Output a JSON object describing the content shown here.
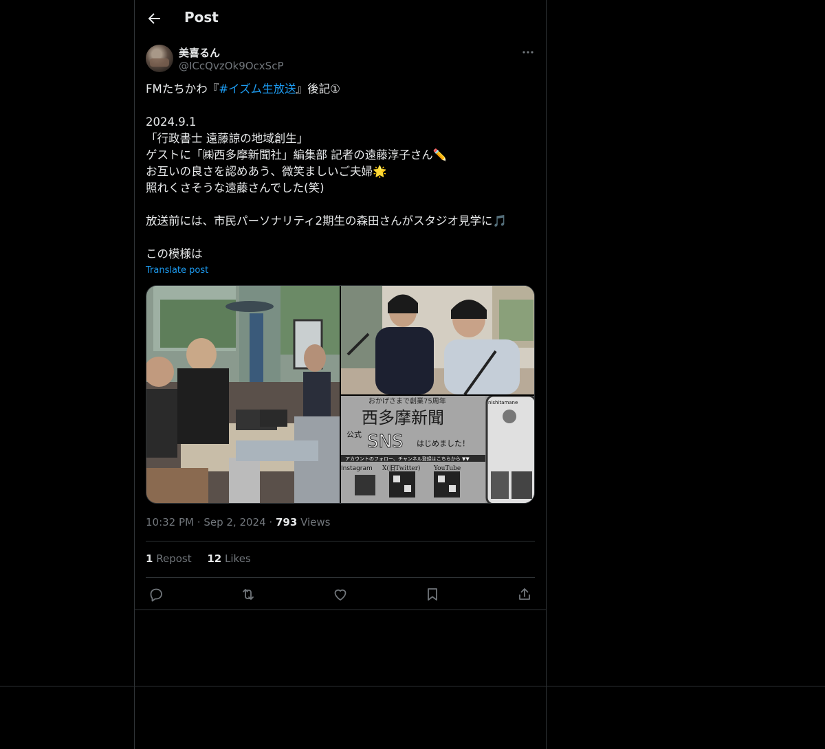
{
  "header": {
    "title": "Post"
  },
  "author": {
    "display_name": "美喜るん",
    "handle": "@ICcQvzOk9OcxScP"
  },
  "post": {
    "line1_prefix": "FMたちかわ『",
    "line1_hashtag": "#イズム生放送",
    "line1_suffix": "』後記①",
    "body": "2024.9.1\n「行政書士 遠藤諒の地域創生」\nゲストに「㈱西多摩新聞社」編集部 記者の遠藤淳子さん✏️\nお互いの良さを認めあう、微笑ましいご夫婦🌟\n照れくさそうな遠藤さんでした(笑)\n\n放送前には、市民パーソナリティ2期生の森田さんがスタジオ見学に🎵\n\nこの模様は",
    "translate_label": "Translate post"
  },
  "media": {
    "sign": {
      "banner_top": "おかげさまで創業75周年",
      "title": "西多摩新聞",
      "badge": "公式",
      "sns": "SNS",
      "sns_suffix": "はじめました！",
      "follow": "アカウントのフォロー、チャンネル登録はこちらから ▼▼",
      "col1": "Instagram",
      "col2": "X(旧Twitter)",
      "col3": "YouTube",
      "profile": "nishitamane"
    }
  },
  "meta": {
    "time": "10:32 PM",
    "date": "Sep 2, 2024",
    "views_count": "793",
    "views_label": "Views",
    "sep": "·"
  },
  "stats": {
    "reposts_count": "1",
    "reposts_label": "Repost",
    "likes_count": "12",
    "likes_label": "Likes"
  },
  "colors": {
    "accent": "#1d9bf0",
    "text": "#e7e9ea",
    "muted": "#71767b",
    "border": "#2f3336"
  }
}
